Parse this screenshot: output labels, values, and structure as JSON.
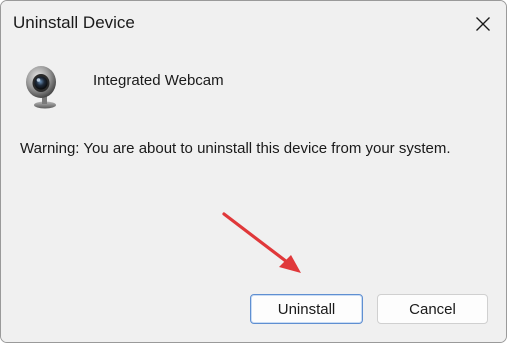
{
  "window": {
    "title": "Uninstall Device",
    "close_icon": "close-icon"
  },
  "device": {
    "icon": "webcam-icon",
    "name": "Integrated Webcam"
  },
  "message": {
    "warning": "Warning: You are about to uninstall this device from your system."
  },
  "annotation": {
    "arrow_icon": "red-arrow-icon",
    "color": "#e0383a"
  },
  "buttons": {
    "uninstall_label": "Uninstall",
    "cancel_label": "Cancel"
  },
  "colors": {
    "background": "#f0f0f0",
    "primary_border": "#5f8fd1"
  }
}
